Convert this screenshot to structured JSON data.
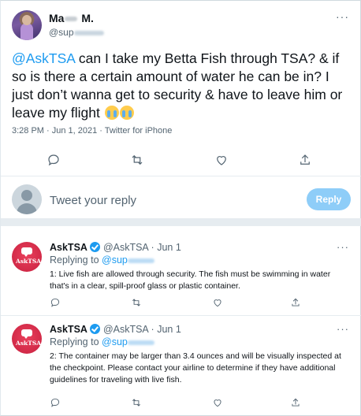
{
  "main_tweet": {
    "name_prefix": "Ma",
    "name_suffix": "M.",
    "handle_prefix": "@sup",
    "more": "···",
    "mention": "@AskTSA",
    "text": " can I take my Betta Fish through TSA? & if so is there a certain amount of water he can be in? I just don’t wanna get to security & have to leave him or leave my flight ",
    "meta": "3:28 PM · Jun 1, 2021 · Twitter for iPhone",
    "actions": [
      "reply-icon",
      "retweet-icon",
      "like-icon",
      "share-icon"
    ]
  },
  "reply_box": {
    "placeholder": "Tweet your reply",
    "button": "Reply"
  },
  "replies": [
    {
      "name": "AskTSA",
      "handle": "@AskTSA · Jun 1",
      "more": "···",
      "replying_to": "Replying to ",
      "replying_handle_prefix": "@sup",
      "logo_text": "AskTSA",
      "body": "1: Live fish are allowed through security. The fish must be swimming in water that's in a clear, spill-proof glass or plastic container."
    },
    {
      "name": "AskTSA",
      "handle": "@AskTSA · Jun 1",
      "more": "···",
      "replying_to": "Replying to ",
      "replying_handle_prefix": "@sup",
      "logo_text": "AskTSA",
      "body": "2: The container may be larger than 3.4 ounces and will be visually inspected at the checkpoint. Please contact your airline to determine if they have additional guidelines for traveling with live fish."
    }
  ],
  "colors": {
    "accent": "#1d9bf0",
    "reply_button_disabled": "#8ecdf8",
    "tsa_red": "#c8203f",
    "muted_text": "#536471"
  }
}
